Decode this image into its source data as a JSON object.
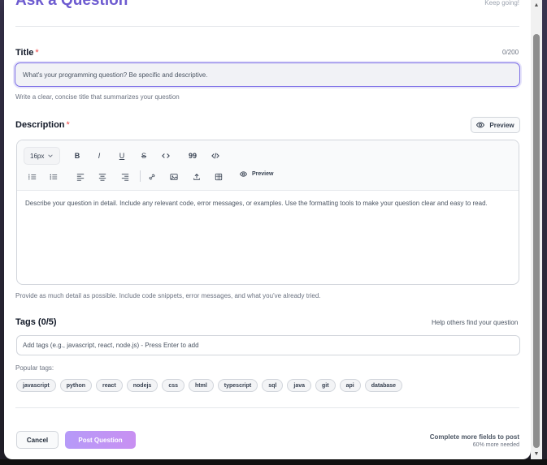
{
  "modal": {
    "title": "Ask a Question",
    "keep_going": "Keep going!"
  },
  "title_field": {
    "label": "Title",
    "required_mark": "*",
    "counter": "0/200",
    "placeholder": "What's your programming question? Be specific and descriptive.",
    "hint": "Write a clear, concise title that summarizes your question"
  },
  "description": {
    "label": "Description",
    "required_mark": "*",
    "preview_button": "Preview",
    "font_size": "16px",
    "toolbar_preview": "Preview",
    "placeholder": "Describe your question in detail. Include any relevant code, error messages, or examples. Use the formatting tools to make your question clear and easy to read.",
    "hint": "Provide as much detail as possible. Include code snippets, error messages, and what you've already tried."
  },
  "tags": {
    "label": "Tags (0/5)",
    "helper": "Help others find your question",
    "placeholder": "Add tags (e.g., javascript, react, node.js) - Press Enter to add",
    "popular_label": "Popular tags:",
    "popular": [
      "javascript",
      "python",
      "react",
      "nodejs",
      "css",
      "html",
      "typescript",
      "sql",
      "java",
      "git",
      "api",
      "database"
    ]
  },
  "footer": {
    "cancel": "Cancel",
    "post": "Post Question",
    "progress_main": "Complete more fields to post",
    "progress_sub": "60% more needed"
  },
  "colors": {
    "accent": "#6d5bd0",
    "post_button": "#c3a0f5",
    "required": "#ef4444"
  }
}
